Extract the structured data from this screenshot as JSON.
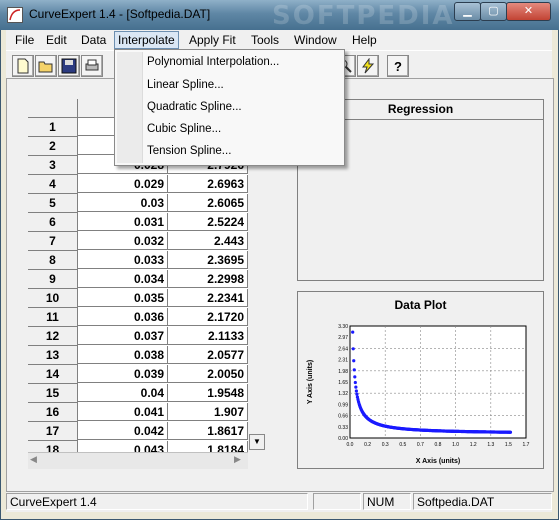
{
  "window": {
    "title": "CurveExpert 1.4 - [Softpedia.DAT]",
    "watermark": "SOFTPEDIA"
  },
  "menubar": [
    "File",
    "Edit",
    "Data",
    "Interpolate",
    "Apply Fit",
    "Tools",
    "Window",
    "Help"
  ],
  "interpolate_menu": [
    "Polynomial Interpolation...",
    "Linear Spline...",
    "Quadratic Spline...",
    "Cubic Spline...",
    "Tension Spline..."
  ],
  "toolbar_icons": [
    "new-file-icon",
    "open-folder-icon",
    "save-disk-icon",
    "print-icon",
    "zoom-icon",
    "lightning-icon",
    "help-icon"
  ],
  "grid": {
    "rows": [
      {
        "n": "1",
        "x": "",
        "y": ""
      },
      {
        "n": "2",
        "x": "",
        "y": ""
      },
      {
        "n": "3",
        "x": "0.028",
        "y": "2.7926"
      },
      {
        "n": "4",
        "x": "0.029",
        "y": "2.6963"
      },
      {
        "n": "5",
        "x": "0.03",
        "y": "2.6065"
      },
      {
        "n": "6",
        "x": "0.031",
        "y": "2.5224"
      },
      {
        "n": "7",
        "x": "0.032",
        "y": "2.443"
      },
      {
        "n": "8",
        "x": "0.033",
        "y": "2.3695"
      },
      {
        "n": "9",
        "x": "0.034",
        "y": "2.2998"
      },
      {
        "n": "10",
        "x": "0.035",
        "y": "2.2341"
      },
      {
        "n": "11",
        "x": "0.036",
        "y": "2.1720"
      },
      {
        "n": "12",
        "x": "0.037",
        "y": "2.1133"
      },
      {
        "n": "13",
        "x": "0.038",
        "y": "2.0577"
      },
      {
        "n": "14",
        "x": "0.039",
        "y": "2.0050"
      },
      {
        "n": "15",
        "x": "0.04",
        "y": "1.9548"
      },
      {
        "n": "16",
        "x": "0.041",
        "y": "1.907"
      },
      {
        "n": "17",
        "x": "0.042",
        "y": "1.8617"
      },
      {
        "n": "18",
        "x": "0.043",
        "y": "1.8184"
      }
    ]
  },
  "regression": {
    "header": "Regression"
  },
  "plot": {
    "title": "Data Plot",
    "xlabel": "X Axis (units)",
    "ylabel": "Y Axis (units)",
    "xticks": [
      "0.0",
      "0.2",
      "0.3",
      "0.5",
      "0.7",
      "0.8",
      "1.0",
      "1.2",
      "1.3",
      "1.5",
      "1.7"
    ],
    "yticks": [
      "3.30",
      "2.97",
      "2.64",
      "2.31",
      "1.98",
      "1.65",
      "1.32",
      "0.99",
      "0.66",
      "0.33",
      "0.00"
    ],
    "marker_color": "#1a1aff"
  },
  "status": {
    "app": "CurveExpert 1.4",
    "num": "NUM",
    "file": "Softpedia.DAT"
  }
}
